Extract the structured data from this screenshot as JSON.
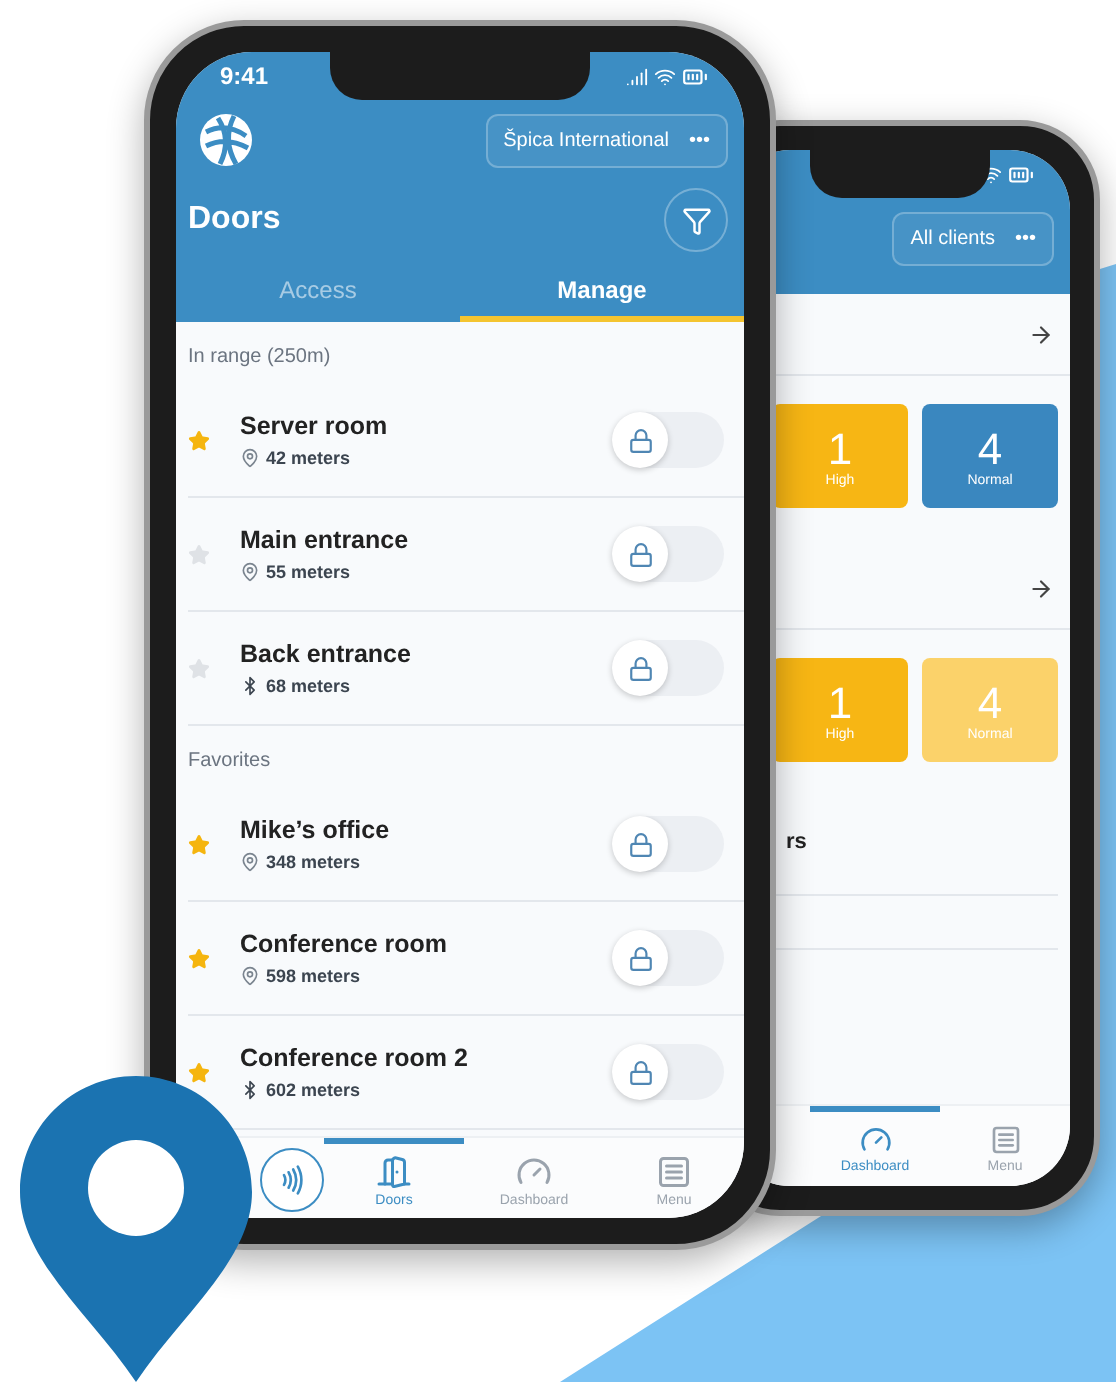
{
  "front_phone": {
    "status_time": "9:41",
    "account": "Špica International",
    "more": "•••",
    "title": "Doors",
    "tabs": [
      {
        "label": "Access",
        "selected": false
      },
      {
        "label": "Manage",
        "selected": true
      }
    ],
    "sections": [
      {
        "heading": "In range (250m)",
        "doors": [
          {
            "name": "Server room",
            "distance": "42 meters",
            "kind": "location",
            "favorite": true,
            "on": false
          },
          {
            "name": "Main entrance",
            "distance": "55 meters",
            "kind": "location",
            "favorite": false,
            "on": false
          },
          {
            "name": "Back entrance",
            "distance": "68 meters",
            "kind": "bluetooth",
            "favorite": false,
            "on": false
          }
        ]
      },
      {
        "heading": "Favorites",
        "doors": [
          {
            "name": "Mike’s office",
            "distance": "348 meters",
            "kind": "location",
            "favorite": true,
            "on": false
          },
          {
            "name": "Conference room",
            "distance": "598 meters",
            "kind": "location",
            "favorite": true,
            "on": false
          },
          {
            "name": "Conference room 2",
            "distance": "602 meters",
            "kind": "bluetooth",
            "favorite": true,
            "on": false
          }
        ]
      }
    ],
    "nav": [
      {
        "label": "Doors",
        "kind": "doors",
        "selected": true
      },
      {
        "label": "Dashboard",
        "kind": "dashboard",
        "selected": false
      },
      {
        "label": "Menu",
        "kind": "menu",
        "selected": false
      }
    ]
  },
  "back_phone": {
    "account": "All clients",
    "more": "•••",
    "groups": [
      {
        "tiles": [
          {
            "value": "1",
            "label": "High",
            "color": "#f7b614"
          },
          {
            "value": "4",
            "label": "Normal",
            "color": "#3a87bf"
          }
        ]
      },
      {
        "tiles": [
          {
            "value": "1",
            "label": "High",
            "color": "#f7b614"
          },
          {
            "value": "4",
            "label": "Normal",
            "color": "#fbd26a"
          }
        ]
      }
    ],
    "partial_text": "rs",
    "nav": [
      {
        "label": "Dashboard",
        "kind": "dashboard",
        "selected": true
      },
      {
        "label": "Menu",
        "kind": "menu",
        "selected": false
      }
    ]
  }
}
